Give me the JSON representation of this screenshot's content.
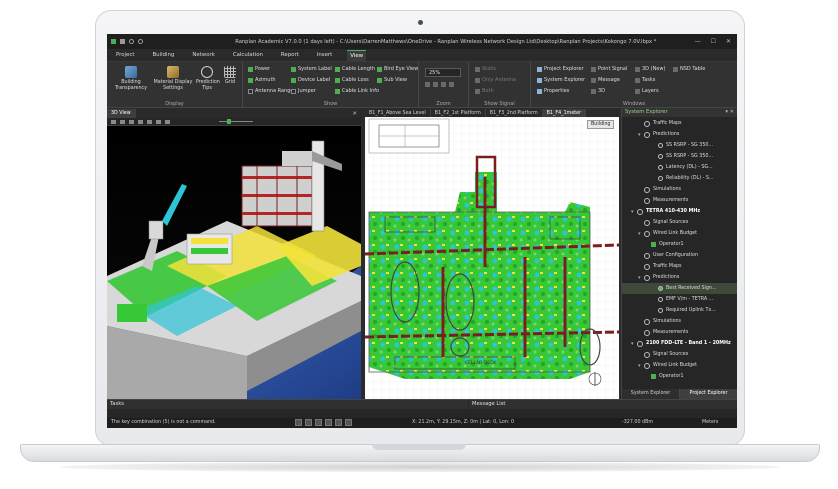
{
  "window": {
    "title": "Ranplan Academic V7.0.0 (1 days left) - C:\\Users\\DarrenMatthews\\OneDrive - Ranplan Wireless Network Design Ltd\\Desktop\\Ranplan Projects\\Kokongo 7.0V.lbpx *",
    "minimize": "—",
    "maximize": "☐",
    "close": "✕"
  },
  "menu": [
    "Project",
    "Building",
    "Network",
    "Calculation",
    "Report",
    "Insert",
    "View"
  ],
  "menu_active": "View",
  "ribbon": {
    "display": {
      "label": "Display",
      "building_transparency": "Building Transparency",
      "material_display": "Material Display Settings",
      "prediction_tips": "Prediction Tips",
      "grid": "Grid"
    },
    "show": {
      "label": "Show",
      "col1": [
        "Power",
        "Azimuth",
        "Antenna Range"
      ],
      "col2": [
        "System Label",
        "Device Label",
        "Jumper"
      ],
      "col3": [
        "Cable Length",
        "Cable Loss",
        "Cable Link Info"
      ],
      "col4": [
        "Bird Eye View",
        "Sub View"
      ]
    },
    "zoom": {
      "label": "Zoom",
      "value": "25%"
    },
    "show_signal": {
      "label": "Show Signal",
      "items": [
        "Static",
        "Only Antenna",
        "Both"
      ]
    },
    "windows": {
      "label": "Windows",
      "col1": [
        "Project Explorer",
        "System Explorer",
        "Properties"
      ],
      "col2": [
        "Point Signal",
        "Message",
        "3D"
      ],
      "col3": [
        "3D (New)",
        "Tasks",
        "Layers"
      ],
      "col4": [
        "NSD Table"
      ]
    }
  },
  "view_tabs": [
    "3D View",
    "B1_F1_Above Sea Level",
    "B1_F2_1st Platform",
    "B1_F3_2nd Platform",
    "B1_F4_1meter"
  ],
  "plan_label": "Building",
  "plan_annotation": "CELLAR DECK",
  "explorer": {
    "title": "System Explorer",
    "items": [
      {
        "text": "Traffic Maps",
        "indent": 2,
        "type": "ico"
      },
      {
        "text": "Predictions",
        "indent": 2,
        "type": "ico",
        "exp": "▾"
      },
      {
        "text": "SS RSRP - SG 350...",
        "indent": 4,
        "type": "radio"
      },
      {
        "text": "SS RSRP - SG 350...",
        "indent": 4,
        "type": "radio"
      },
      {
        "text": "Latency (DL) - SG...",
        "indent": 4,
        "type": "radio"
      },
      {
        "text": "Reliability (DL) - S...",
        "indent": 4,
        "type": "radio"
      },
      {
        "text": "Simulations",
        "indent": 2,
        "type": "ico"
      },
      {
        "text": "Measurements",
        "indent": 2,
        "type": "ico"
      },
      {
        "text": "TETRA 410-430 MHz",
        "indent": 1,
        "type": "ico",
        "exp": "▾",
        "bold": true
      },
      {
        "text": "Signal Sources",
        "indent": 2,
        "type": "ico"
      },
      {
        "text": "Wired Link Budget",
        "indent": 2,
        "type": "ico",
        "exp": "▾"
      },
      {
        "text": "Operator1",
        "indent": 3,
        "type": "chk"
      },
      {
        "text": "User Configuration",
        "indent": 2,
        "type": "ico"
      },
      {
        "text": "Traffic Maps",
        "indent": 2,
        "type": "ico"
      },
      {
        "text": "Predictions",
        "indent": 2,
        "type": "ico",
        "exp": "▾"
      },
      {
        "text": "Best Received Sign...",
        "indent": 4,
        "type": "radio",
        "selected": true
      },
      {
        "text": "EMF V/m - TETRA ...",
        "indent": 4,
        "type": "radio"
      },
      {
        "text": "Required Uplink Tx...",
        "indent": 4,
        "type": "radio"
      },
      {
        "text": "Simulations",
        "indent": 2,
        "type": "ico"
      },
      {
        "text": "Measurements",
        "indent": 2,
        "type": "ico"
      },
      {
        "text": "2100 FDD-LTE - Band 1 - 20MHz",
        "indent": 1,
        "type": "ico",
        "exp": "▾",
        "bold": true
      },
      {
        "text": "Signal Sources",
        "indent": 2,
        "type": "ico"
      },
      {
        "text": "Wired Link Budget",
        "indent": 2,
        "type": "ico",
        "exp": "▾"
      },
      {
        "text": "Operator1",
        "indent": 3,
        "type": "chk"
      }
    ],
    "tabs": [
      "System Explorer",
      "Project Explorer"
    ]
  },
  "panels": {
    "tasks": "Tasks",
    "messages": "Message List"
  },
  "status": {
    "message": "The key combination (5) is not a command.",
    "coords": "X: 21.2m, Y: 29.15m, Z: 0m | Lat: 0, Lon: 0",
    "signal": "-327.00 dBm",
    "units": "Meters"
  },
  "colors": {
    "accent": "#4caf50",
    "plan_walls": "#7a1f1f",
    "heat_green": "#37c837",
    "heat_cyan": "#2ec4d8",
    "heat_yellow": "#f2e23a"
  }
}
